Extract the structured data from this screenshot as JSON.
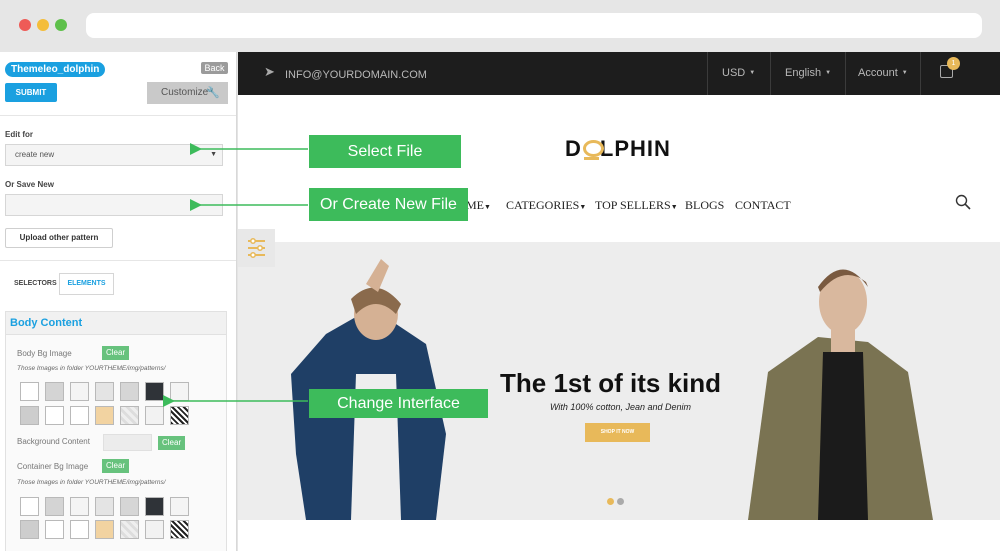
{
  "panel": {
    "theme_name": "Themeleo_dolphin",
    "back_label": "Back",
    "submit_label": "SUBMIT",
    "customize_label": "Customize",
    "edit_for_label": "Edit for",
    "edit_for_value": "create new",
    "or_save_new_label": "Or Save New",
    "upload_label": "Upload other pattern",
    "tab_selectors": "SELECTORS",
    "tab_elements": "ELEMENTS",
    "body_content": {
      "title": "Body Content",
      "body_bg_image_label": "Body Bg Image",
      "clear_label": "Clear",
      "folder_note": "Those Images in folder YOURTHEME/img/patterns/",
      "background_content_label": "Background Content",
      "container_bg_image_label": "Container Bg Image"
    }
  },
  "site": {
    "email": "INFO@YOURDOMAIN.COM",
    "currency": "USD",
    "language": "English",
    "account": "Account",
    "cart_count": "1",
    "logo_left": "D",
    "logo_right": "LPHIN",
    "nav": [
      "ME",
      "CATEGORIES",
      "TOP SELLERS",
      "BLOGS",
      "CONTACT"
    ],
    "hero_title": "The 1st of its kind",
    "hero_subtitle": "With 100% cotton, Jean and Denim",
    "shop_button": "SHOP IT NOW"
  },
  "callouts": {
    "select_file": "Select File",
    "create_new_file": "Or Create New File",
    "change_interface": "Change Interface"
  },
  "colors": {
    "accent_blue": "#1aa0e0",
    "callout_green": "#3dbb5b",
    "brand_gold": "#e8b95a"
  },
  "icons": [
    "send-icon",
    "cart-icon",
    "search-icon",
    "wrench-icon",
    "sliders-icon"
  ]
}
